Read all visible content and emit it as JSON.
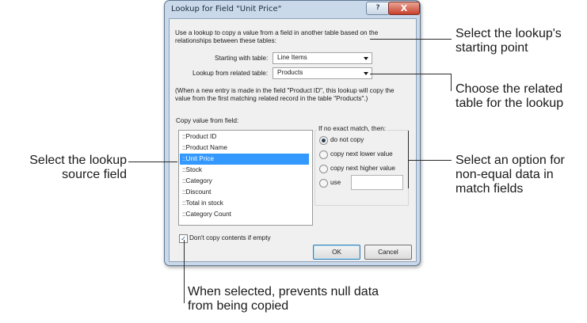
{
  "dialog": {
    "title": "Lookup for Field \"Unit Price\"",
    "help_label": "?",
    "close_label": "X",
    "intro_line1": "Use a lookup to copy a value from a field in another table based on the",
    "intro_line2": "relationships between these tables:",
    "starting_label": "Starting with table:",
    "starting_value": "Line Items",
    "related_label": "Lookup from related table:",
    "related_value": "Products",
    "note_line1": "(When a new entry is made in the field \"Product ID\", this lookup will copy the",
    "note_line2": "value from the first matching related record in the table \"Products\".)",
    "copy_label": "Copy value from field:",
    "fields": [
      "::Product ID",
      "::Product Name",
      "::Unit Price",
      "::Stock",
      "::Category",
      "::Discount",
      "::Total in stock",
      "::Category Count"
    ],
    "selected_field": "::Unit Price",
    "nomatch_label": "If no exact match, then:",
    "options": [
      "do not copy",
      "copy next lower value",
      "copy next higher value",
      "use"
    ],
    "selected_option": "do not copy",
    "use_value": "",
    "dont_copy_label": "Don't copy contents if empty",
    "dont_copy_checked": true,
    "ok_label": "OK",
    "cancel_label": "Cancel"
  },
  "callouts": {
    "starting_point_1": "Select the lookup's",
    "starting_point_2": "starting point",
    "related_table_1": "Choose the related",
    "related_table_2": "table for the lookup",
    "option_1": "Select an option for",
    "option_2": "non-equal data in",
    "option_3": "match fields",
    "source_1": "Select the lookup",
    "source_2": "source field",
    "null_1": "When selected, prevents null data",
    "null_2": "from being copied"
  }
}
